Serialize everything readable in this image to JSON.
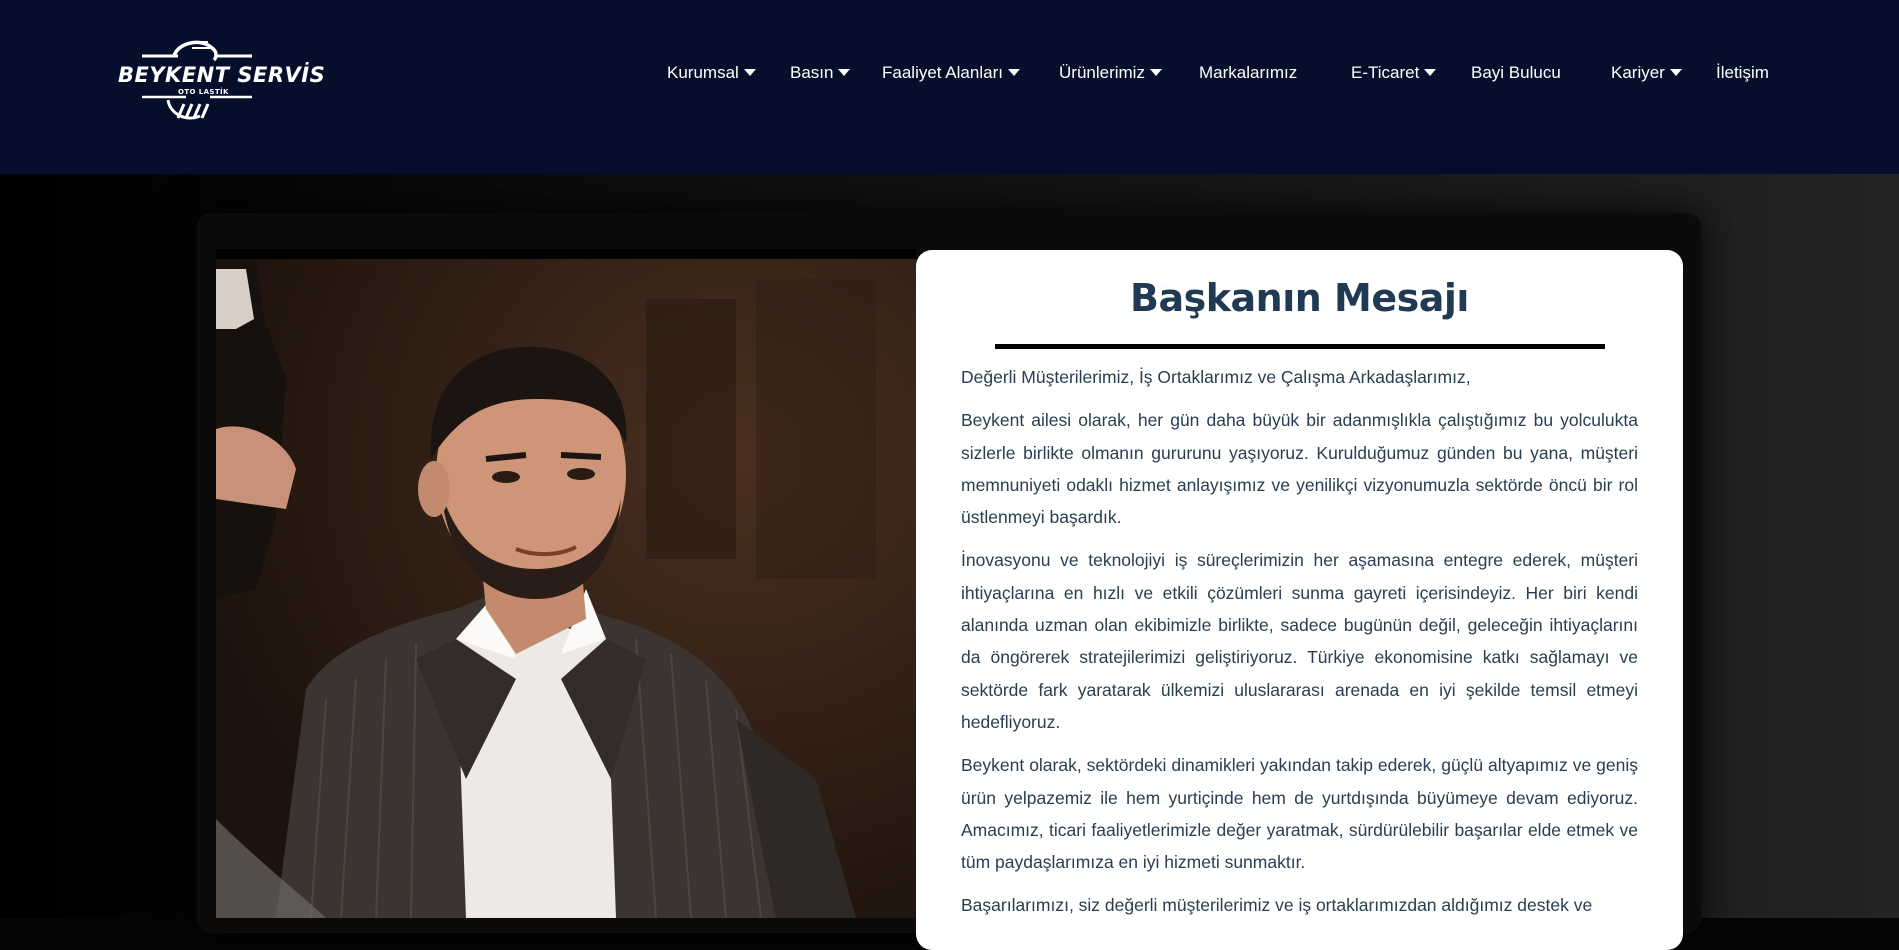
{
  "brand": {
    "name": "BEYKENT SERVİS",
    "tagline": "OTO LASTİK"
  },
  "nav": {
    "items": [
      {
        "label": "Kurumsal",
        "has_dropdown": true
      },
      {
        "label": "Basın",
        "has_dropdown": true
      },
      {
        "label": "Faaliyet Alanları",
        "has_dropdown": true
      },
      {
        "label": "Ürünlerimiz",
        "has_dropdown": true
      },
      {
        "label": "Markalarımız",
        "has_dropdown": false
      },
      {
        "label": "E-Ticaret",
        "has_dropdown": true
      },
      {
        "label": "Bayi Bulucu",
        "has_dropdown": false
      },
      {
        "label": "Kariyer",
        "has_dropdown": true
      },
      {
        "label": "İletişim",
        "has_dropdown": false
      }
    ]
  },
  "message": {
    "title": "Başkanın Mesajı",
    "paragraphs": [
      "Değerli Müşterilerimiz, İş Ortaklarımız ve Çalışma Arkadaşlarımız,",
      "Beykent ailesi olarak, her gün daha büyük bir adanmışlıkla çalıştığımız bu yolculukta sizlerle birlikte olmanın gururunu yaşıyoruz. Kurulduğumuz günden bu yana, müşteri memnuniyeti odaklı hizmet anlayışımız ve yenilikçi vizyonumuzla sektörde öncü bir rol üstlenmeyi başardık.",
      "İnovasyonu ve teknolojiyi iş süreçlerimizin her aşamasına entegre ederek, müşteri ihtiyaçlarına en hızlı ve etkili çözümleri sunma gayreti içerisindeyiz. Her biri kendi alanında uzman olan ekibimizle birlikte, sadece bugünün değil, geleceğin ihtiyaçlarını da öngörerek stratejilerimizi geliştiriyoruz. Türkiye ekonomisine katkı sağlamayı ve sektörde fark yaratarak ülkemizi uluslararası arenada en iyi şekilde temsil etmeyi hedefliyoruz.",
      "Beykent olarak, sektördeki dinamikleri yakından takip ederek, güçlü altyapımız ve geniş ürün yelpazemiz ile hem yurtiçinde hem de yurtdışında büyümeye devam ediyoruz. Amacımız, ticari faaliyetlerimizle değer yaratmak, sürdürülebilir başarılar elde etmek ve tüm paydaşlarımıza en iyi hizmeti sunmaktır.",
      "Başarılarımızı, siz değerli müşterilerimiz ve iş ortaklarımızdan aldığımız destek ve"
    ]
  },
  "colors": {
    "header_bg": "#050f2b",
    "title": "#1f3a52",
    "body_text": "#2a3d52"
  }
}
